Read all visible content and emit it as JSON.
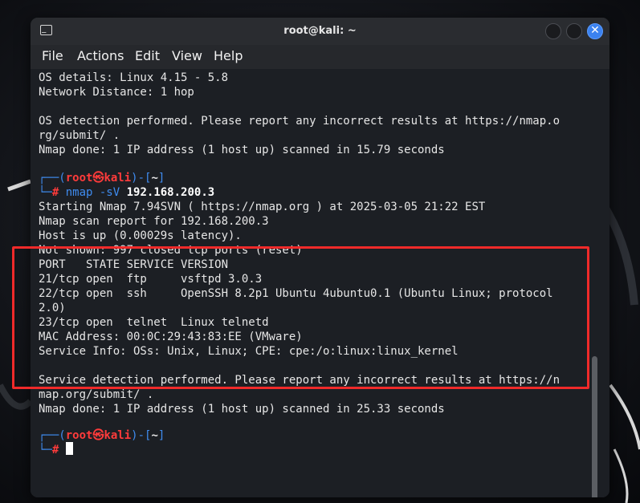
{
  "window": {
    "title": "root@kali: ~",
    "app_icon_glyph": "_"
  },
  "menu": {
    "file": "File",
    "actions": "Actions",
    "edit": "Edit",
    "view": "View",
    "help": "Help"
  },
  "controls": {
    "close_glyph": "✕"
  },
  "terminal": {
    "lines": [
      "OS details: Linux 4.15 - 5.8",
      "Network Distance: 1 hop",
      "",
      "OS detection performed. Please report any incorrect results at https://nmap.o",
      "rg/submit/ .",
      "Nmap done: 1 IP address (1 host up) scanned in 15.79 seconds"
    ],
    "prompt1": {
      "corner_open": "┌──(",
      "user": "root",
      "at": "㉿",
      "host": "kali",
      "mid": ")-[",
      "dir": "~",
      "close": "]",
      "corner2": "└─",
      "hash": "#",
      "cmd": "nmap -sV",
      "ip": "192.168.200.3"
    },
    "scan_lines": [
      "Starting Nmap 7.94SVN ( https://nmap.org ) at 2025-03-05 21:22 EST",
      "Nmap scan report for 192.168.200.3",
      "Host is up (0.00029s latency).",
      "Not shown: 997 closed tcp ports (reset)",
      "PORT   STATE SERVICE VERSION",
      "21/tcp open  ftp     vsftpd 3.0.3",
      "22/tcp open  ssh     OpenSSH 8.2p1 Ubuntu 4ubuntu0.1 (Ubuntu Linux; protocol",
      "2.0)",
      "23/tcp open  telnet  Linux telnetd",
      "MAC Address: 00:0C:29:43:83:EE (VMware)",
      "Service Info: OSs: Unix, Linux; CPE: cpe:/o:linux:linux_kernel",
      "",
      "Service detection performed. Please report any incorrect results at https://n",
      "map.org/submit/ .",
      "Nmap done: 1 IP address (1 host up) scanned in 25.33 seconds"
    ],
    "prompt2": {
      "corner_open": "┌──(",
      "user": "root",
      "at": "㉿",
      "host": "kali",
      "mid": ")-[",
      "dir": "~",
      "close": "]",
      "corner2": "└─",
      "hash": "#"
    }
  },
  "colors": {
    "prompt_blue": "#3f8cf0",
    "prompt_red": "#ff3b3b",
    "highlight_red": "#f02a2a",
    "close_button_blue": "#3b82f0"
  }
}
